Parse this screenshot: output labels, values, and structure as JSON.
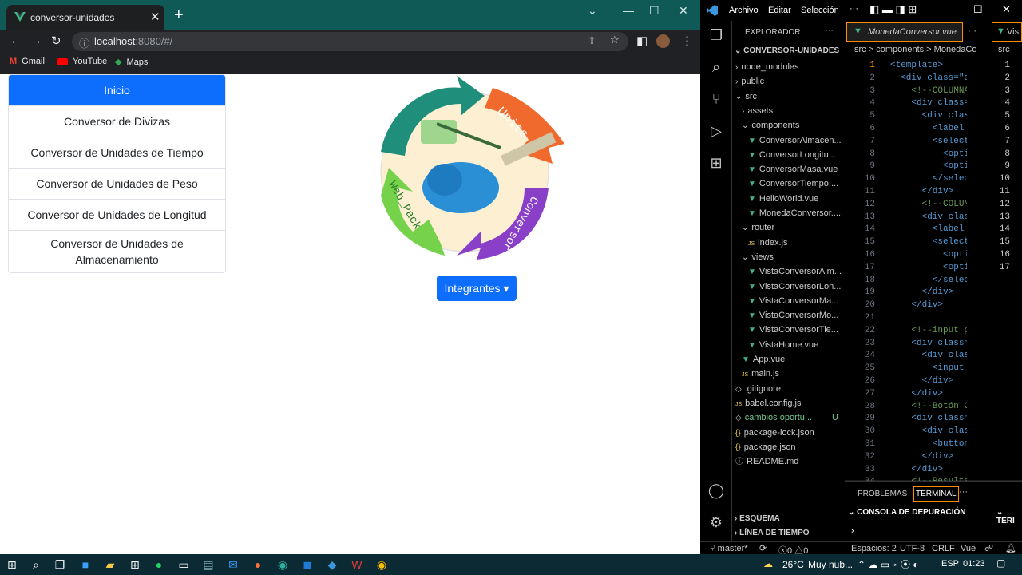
{
  "browser": {
    "tab_title": "conversor-unidades",
    "url_host": "localhost",
    "url_rest": ":8080/#/",
    "bookmarks": [
      "Gmail",
      "YouTube",
      "Maps"
    ]
  },
  "app": {
    "menu": [
      "Inicio",
      "Conversor de Divizas",
      "Conversor de Unidades de Tiempo",
      "Conversor de Unidades de Peso",
      "Conversor de Unidades de Longitud",
      "Conversor de Unidades de Almacenamiento"
    ],
    "logo_texts": [
      "Units",
      "Web_Pack",
      "Conversor"
    ],
    "integrantes_label": "Integrantes"
  },
  "vscode": {
    "menu": [
      "Archivo",
      "Editar",
      "Selección"
    ],
    "explorer_title": "EXPLORADOR",
    "project": "CONVERSOR-UNIDADES",
    "tree": [
      {
        "label": "node_modules",
        "depth": 1,
        "kind": "folder",
        "open": false
      },
      {
        "label": "public",
        "depth": 1,
        "kind": "folder",
        "open": false
      },
      {
        "label": "src",
        "depth": 1,
        "kind": "folder",
        "open": true
      },
      {
        "label": "assets",
        "depth": 2,
        "kind": "folder",
        "open": false
      },
      {
        "label": "components",
        "depth": 2,
        "kind": "folder",
        "open": true
      },
      {
        "label": "ConversorAlmacen...",
        "depth": 3,
        "kind": "vue"
      },
      {
        "label": "ConversorLongitu...",
        "depth": 3,
        "kind": "vue"
      },
      {
        "label": "ConversorMasa.vue",
        "depth": 3,
        "kind": "vue"
      },
      {
        "label": "ConversorTiempo....",
        "depth": 3,
        "kind": "vue"
      },
      {
        "label": "HelloWorld.vue",
        "depth": 3,
        "kind": "vue"
      },
      {
        "label": "MonedaConversor....",
        "depth": 3,
        "kind": "vue"
      },
      {
        "label": "router",
        "depth": 2,
        "kind": "folder",
        "open": true
      },
      {
        "label": "index.js",
        "depth": 3,
        "kind": "js"
      },
      {
        "label": "views",
        "depth": 2,
        "kind": "folder",
        "open": true
      },
      {
        "label": "VistaConversorAlm...",
        "depth": 3,
        "kind": "vue"
      },
      {
        "label": "VistaConversorLon...",
        "depth": 3,
        "kind": "vue"
      },
      {
        "label": "VistaConversorMa...",
        "depth": 3,
        "kind": "vue"
      },
      {
        "label": "VistaConversorMo...",
        "depth": 3,
        "kind": "vue"
      },
      {
        "label": "VistaConversorTie...",
        "depth": 3,
        "kind": "vue"
      },
      {
        "label": "VistaHome.vue",
        "depth": 3,
        "kind": "vue"
      },
      {
        "label": "App.vue",
        "depth": 2,
        "kind": "vue"
      },
      {
        "label": "main.js",
        "depth": 2,
        "kind": "js"
      },
      {
        "label": ".gitignore",
        "depth": 1,
        "kind": "file"
      },
      {
        "label": "babel.config.js",
        "depth": 1,
        "kind": "js"
      },
      {
        "label": "cambios oportu...",
        "depth": 1,
        "kind": "file",
        "badge": "U"
      },
      {
        "label": "package-lock.json",
        "depth": 1,
        "kind": "json"
      },
      {
        "label": "package.json",
        "depth": 1,
        "kind": "json"
      },
      {
        "label": "README.md",
        "depth": 1,
        "kind": "info"
      }
    ],
    "active_tab": "MonedaConversor.vue",
    "second_tab": "Vis",
    "breadcrumb": "src > components > MonedaCo",
    "breadcrumb2": "src",
    "code_lines": [
      "<template>",
      "  <div class=\"co",
      "    <!--COLUMNA",
      "    <div class=",
      "      <div clas",
      "        <label",
      "        <select",
      "          <opti",
      "          <opti",
      "        </selec",
      "      </div>",
      "      <!--COLUM",
      "      <div clas",
      "        <label",
      "        <select",
      "          <opti",
      "          <opti",
      "        </selec",
      "      </div>",
      "    </div>",
      "",
      "    <!--input p",
      "    <div class=",
      "      <div clas",
      "        <input",
      "      </div>",
      "    </div>",
      "    <!--Botón C",
      "    <div class=",
      "      <div clas",
      "        <button",
      "      </div>",
      "    </div>",
      "    <!--Resulta"
    ],
    "line_count_2": 17,
    "panel_tabs": [
      "PROBLEMAS",
      "TERMINAL"
    ],
    "outline": "ESQUEMA",
    "timeline": "LÍNEA DE TIEMPO",
    "debug_console": "CONSOLA DE DEPURACIÓN",
    "term_short": "TERI",
    "status": {
      "branch": "master*",
      "problems": "0",
      "warnings": "0",
      "spaces": "Espacios: 2",
      "encoding": "UTF-8",
      "eol": "CRLF",
      "lang": "Vue"
    }
  },
  "taskbar": {
    "weather": "26°C",
    "weather_text": "Muy nub...",
    "lang": "ESP",
    "time": "01:23"
  }
}
